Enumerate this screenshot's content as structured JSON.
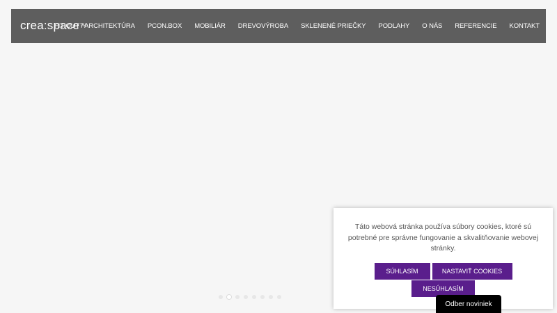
{
  "header": {
    "logo": "crea:space",
    "logo_mark": "TM",
    "nav": [
      {
        "label": "FIT-OUT / ARCHITEKTÚRA"
      },
      {
        "label": "PCON.BOX"
      },
      {
        "label": "MOBILIÁR"
      },
      {
        "label": "DREVOVÝROBA"
      },
      {
        "label": "SKLENENÉ PRIEČKY"
      },
      {
        "label": "PODLAHY"
      },
      {
        "label": "O NÁS"
      },
      {
        "label": "REFERENCIE"
      },
      {
        "label": "KONTAKT"
      }
    ]
  },
  "slider": {
    "dot_count": 8,
    "active_dot": 2
  },
  "cookie_banner": {
    "text": "Táto webová stránka používa súbory cookies, ktoré sú potrebné pre správne fungovanie a skvalitňovanie webovej stránky.",
    "accept_label": "SÚHLASÍM",
    "settings_label": "NASTAVIŤ COOKIES",
    "decline_label": "NESÚHLASÍM",
    "button_color": "#5a1e8c"
  },
  "newsletter": {
    "label": "Odber noviniek"
  },
  "colors": {
    "header_bg": "#5e5e5e",
    "page_bg": "#f6f6f6"
  }
}
